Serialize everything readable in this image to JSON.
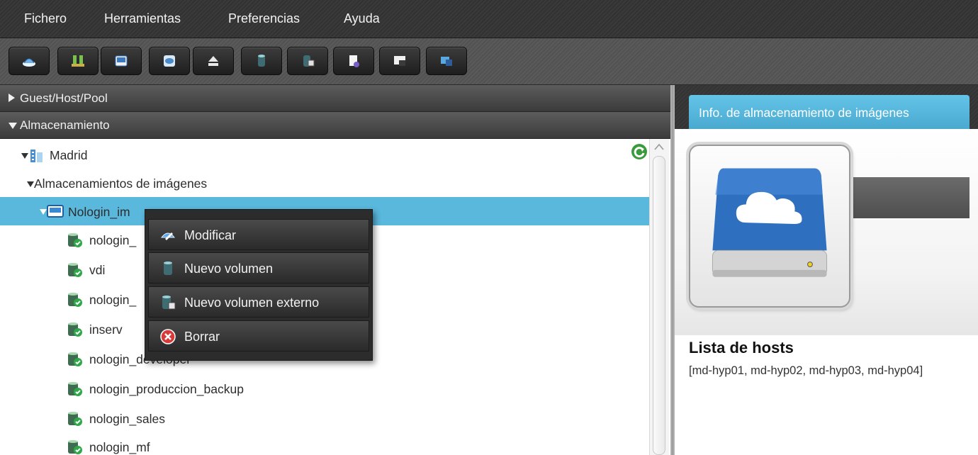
{
  "menubar": {
    "items": [
      "Fichero",
      "Herramientas",
      "Preferencias",
      "Ayuda"
    ]
  },
  "toolbar": {
    "buttons": [
      "storage-icon",
      "network-icon",
      "image-store-icon",
      "disk-icon",
      "eject-icon",
      "volume-icon",
      "external-volume-icon",
      "document-icon",
      "console-icon",
      "window-icon"
    ]
  },
  "left_panel": {
    "sections": {
      "guest_host_pool": "Guest/Host/Pool",
      "almacenamiento": "Almacenamiento"
    },
    "tree": {
      "root": "Madrid",
      "group": "Almacenamientos de imágenes",
      "selected": "Nologin_im",
      "volumes": [
        "nologin_",
        "vdi",
        "nologin_",
        "inserv",
        "nologin_developer",
        "nologin_produccion_backup",
        "nologin_sales",
        "nologin_mf"
      ]
    }
  },
  "context_menu": {
    "items": [
      {
        "label": "Modificar",
        "icon": "edit-icon"
      },
      {
        "label": "Nuevo volumen",
        "icon": "volume-icon"
      },
      {
        "label": "Nuevo volumen externo",
        "icon": "external-volume-icon"
      },
      {
        "label": "Borrar",
        "icon": "delete-icon"
      }
    ]
  },
  "right_panel": {
    "tab": "Info. de almacenamiento de imágenes",
    "hosts_title": "Lista de hosts",
    "hosts_list": "[md-hyp01, md-hyp02, md-hyp03, md-hyp04]"
  },
  "colors": {
    "selection": "#5ab8dc",
    "tab": "#5ab8dc",
    "menubar": "#363636"
  }
}
